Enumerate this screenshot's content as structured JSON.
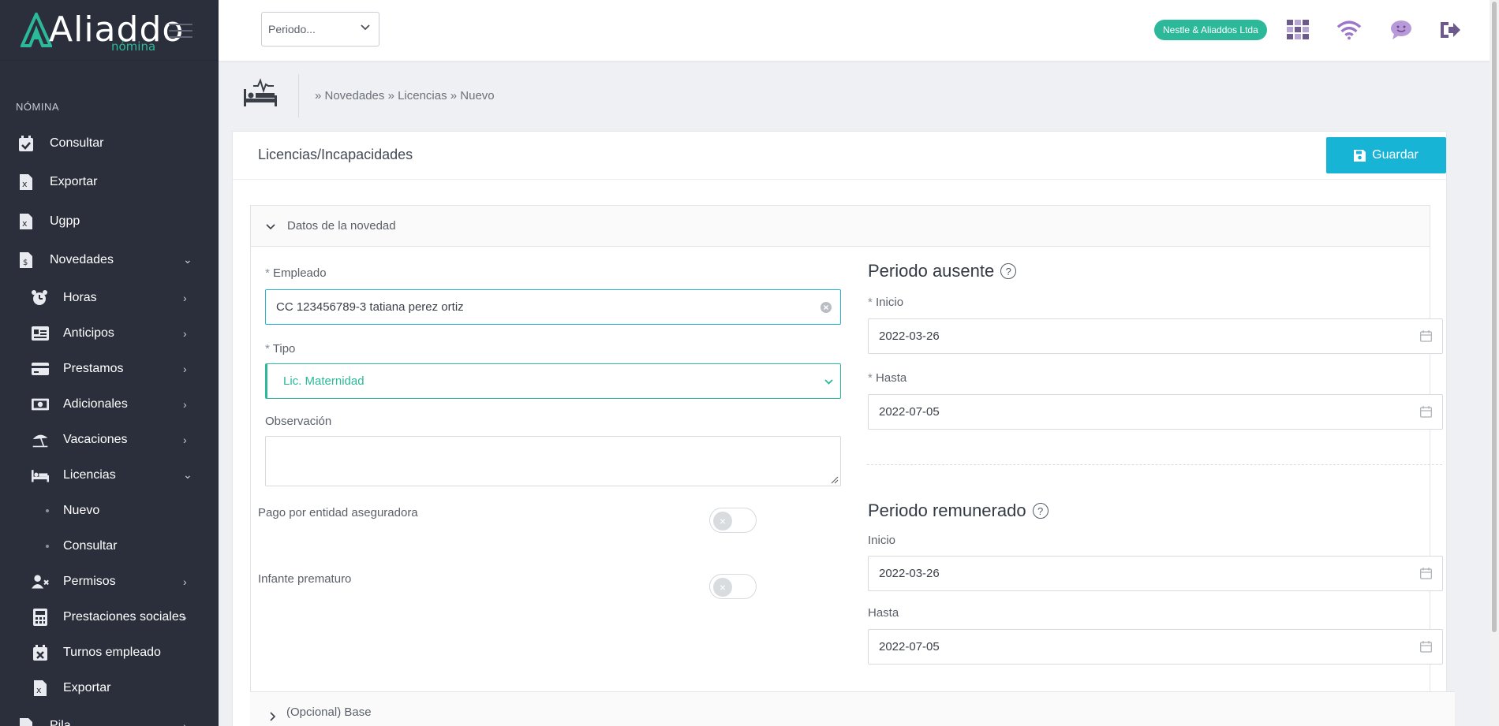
{
  "app": {
    "logo_text": "Aliaddo",
    "logo_sub": "nómina"
  },
  "header": {
    "period_select": "Periodo...",
    "company_badge": "Nestle & Aliaddos Ltda",
    "icons": [
      "apps-grid-icon",
      "wifi-icon",
      "chat-smile-icon",
      "logout-icon"
    ]
  },
  "sidebar": {
    "section": "NÓMINA",
    "items": [
      {
        "label": "Consultar",
        "icon": "calendar-check-icon"
      },
      {
        "label": "Exportar",
        "icon": "excel-file-icon"
      },
      {
        "label": "Ugpp",
        "icon": "excel-file-icon"
      },
      {
        "label": "Novedades",
        "icon": "money-file-icon",
        "expanded": true
      },
      {
        "label": "Horas",
        "icon": "alarm-clock-icon"
      },
      {
        "label": "Anticipos",
        "icon": "id-card-icon"
      },
      {
        "label": "Prestamos",
        "icon": "credit-card-icon"
      },
      {
        "label": "Adicionales",
        "icon": "cash-icon"
      },
      {
        "label": "Vacaciones",
        "icon": "beach-umbrella-icon"
      },
      {
        "label": "Licencias",
        "icon": "bed-icon",
        "expanded": true
      },
      {
        "label": "Nuevo"
      },
      {
        "label": "Consultar"
      },
      {
        "label": "Permisos",
        "icon": "user-x-icon"
      },
      {
        "label": "Prestaciones sociales",
        "icon": "calculator-icon"
      },
      {
        "label": "Turnos empleado",
        "icon": "calendar-x-icon"
      },
      {
        "label": "Exportar",
        "icon": "excel-file-icon"
      },
      {
        "label": "Pila",
        "icon": "file-icon"
      }
    ]
  },
  "breadcrumb": "» Novedades » Licencias » Nuevo",
  "card": {
    "title": "Licencias/Incapacidades",
    "save_label": "Guardar",
    "panel_title": "Datos de la novedad",
    "optional_panel_title": "(Opcional) Base"
  },
  "form": {
    "empleado": {
      "label": "Empleado",
      "value": "CC 123456789-3 tatiana perez ortiz"
    },
    "tipo": {
      "label": "Tipo",
      "value": "Lic. Maternidad"
    },
    "observacion": {
      "label": "Observación",
      "value": ""
    },
    "pago_entidad": {
      "label": "Pago por entidad aseguradora",
      "on": false
    },
    "infante_prematuro": {
      "label": "Infante prematuro",
      "on": false
    },
    "required_mark": "*",
    "periodo_ausente": {
      "title": "Periodo ausente",
      "inicio_label": "Inicio",
      "inicio": "2022-03-26",
      "hasta_label": "Hasta",
      "hasta": "2022-07-05"
    },
    "periodo_remunerado": {
      "title": "Periodo remunerado",
      "inicio_label": "Inicio",
      "inicio": "2022-03-26",
      "hasta_label": "Hasta",
      "hasta": "2022-07-05"
    }
  },
  "colors": {
    "sidebar_bg": "#2b2f3b",
    "accent_green": "#2bb99a",
    "button_cyan": "#18b4d6",
    "icon_purple": "#9b76c9"
  }
}
